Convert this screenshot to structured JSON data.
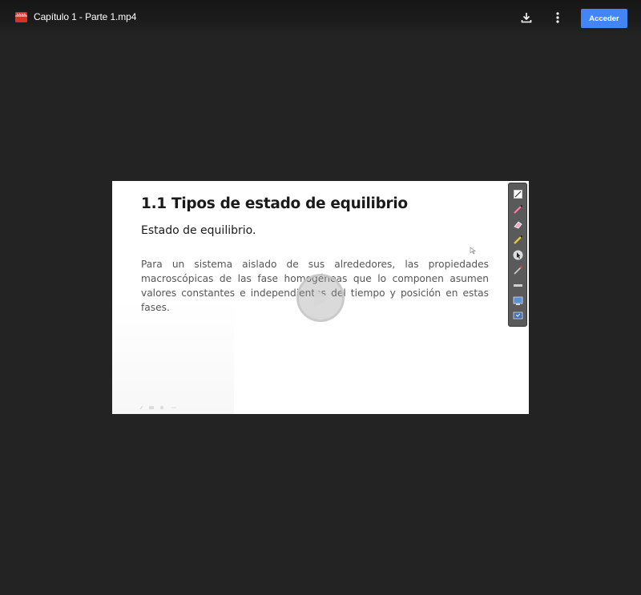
{
  "header": {
    "file_title": "Capítulo 1 - Parte 1.mp4",
    "file_icon": "video-file-icon",
    "download_icon": "download-icon",
    "more_icon": "more-vert-icon",
    "signin_label": "Acceder",
    "colors": {
      "background": "#232323",
      "accent": "#4285f4",
      "file_icon": "#d93025"
    }
  },
  "video": {
    "slide": {
      "title": "1.1 Tipos de estado de equilibrio",
      "subtitle": "Estado de equilibrio.",
      "paragraph": "Para un sistema aislado de sus alrededores, las propiedades macroscópicas de las fase homogéneas que lo componen asumen valores constantes e independientes del tiempo y posición en estas fases."
    },
    "play_icon": "play-icon",
    "toolbar_tools": [
      "page-icon",
      "pen-icon",
      "eraser-icon",
      "highlighter-icon",
      "pointer-icon",
      "laser-pen-icon",
      "line-icon",
      "screen-icon",
      "display-icon"
    ]
  }
}
